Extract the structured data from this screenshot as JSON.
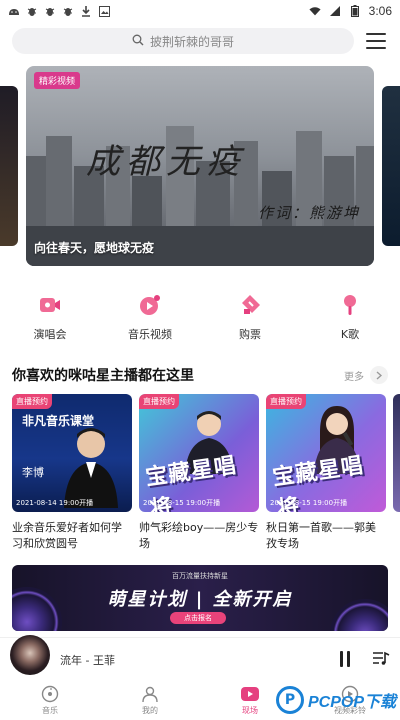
{
  "status_bar": {
    "time": "3:06",
    "left_icons": [
      "android-icon",
      "bug-icon",
      "bug-icon",
      "bug-icon",
      "download-icon",
      "image-icon"
    ],
    "right_icons": [
      "wifi-icon",
      "signal-icon",
      "battery-icon"
    ]
  },
  "search": {
    "placeholder": "披荆斩棘的哥哥"
  },
  "banner": {
    "tag": "精彩视频",
    "headline": "成都无疫",
    "credit": "作词：熊游坤",
    "caption": "向往春天，愿地球无疫"
  },
  "quick_entries": [
    {
      "label": "演唱会",
      "icon": "concert-icon"
    },
    {
      "label": "音乐视频",
      "icon": "music-video-icon"
    },
    {
      "label": "购票",
      "icon": "ticket-icon"
    },
    {
      "label": "K歌",
      "icon": "microphone-icon"
    }
  ],
  "section": {
    "title": "你喜欢的咪咕星主播都在这里",
    "more_label": "更多"
  },
  "cards": [
    {
      "badge": "直播预约",
      "art_title": "非凡音乐课堂",
      "art_name": "李博",
      "date": "2021-08-14 19:00开播",
      "title": "业余音乐爱好者如何学习和欣赏圆号"
    },
    {
      "badge": "直播预约",
      "art_title": "宝藏星唱将",
      "date": "2021-08-15 19:00开播",
      "title": "帅气彩绘boy——房少专场"
    },
    {
      "badge": "直播预约",
      "art_title": "宝藏星唱将",
      "date": "2021-08-15 19:00开播",
      "title": "秋日第一首歌——郭美孜专场"
    }
  ],
  "promo": {
    "top_text": "百万流量扶持新星",
    "main_text": "萌星计划 | 全新开启",
    "button": "点击报名"
  },
  "player": {
    "song": "流年 - 王菲"
  },
  "tabs": [
    {
      "label": "音乐",
      "icon": "music-disc-icon",
      "active": false
    },
    {
      "label": "我的",
      "icon": "user-icon",
      "active": false
    },
    {
      "label": "现场",
      "icon": "live-icon",
      "active": true
    },
    {
      "label": "视频彩铃",
      "icon": "video-ringtone-icon",
      "active": false
    }
  ],
  "watermark": {
    "logo_letter": "P",
    "text": "PCPOP下载"
  },
  "colors": {
    "accent": "#e5407f",
    "badge": "#e94475",
    "watermark": "#1a82d6"
  }
}
